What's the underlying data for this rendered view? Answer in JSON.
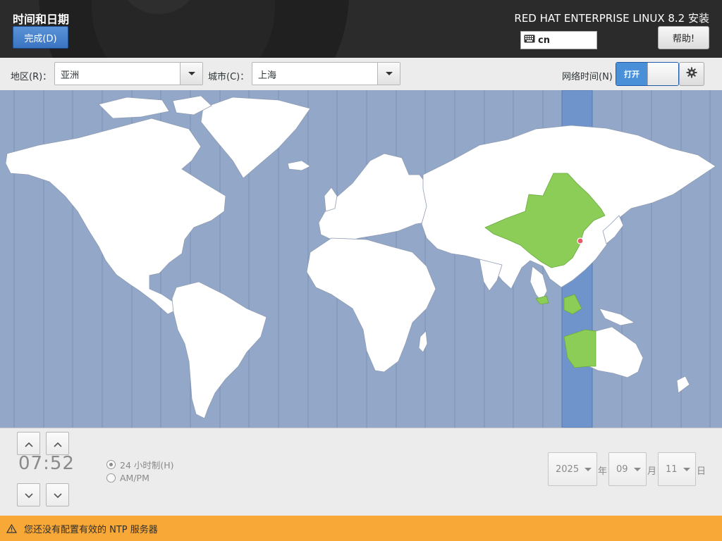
{
  "header": {
    "title": "时间和日期",
    "done_label": "完成(D)",
    "product_title": "RED HAT ENTERPRISE LINUX 8.2 安装",
    "keyboard_layout": "cn",
    "keyboard_icon": "keyboard-icon",
    "help_label": "帮助!"
  },
  "toolbar": {
    "region_label": "地区(R)：",
    "region_value": "亚洲",
    "city_label": "城市(C)：",
    "city_value": "上海",
    "network_time_label": "网络时间(N)",
    "network_time_state": "打开",
    "settings_icon": "gear-icon"
  },
  "map": {
    "selected_timezone": "Asia/Shanghai",
    "ocean_color": "#93a7c9",
    "land_color": "#ffffff",
    "highlight_color": "#8ccd58",
    "band_color": "#6f93cb"
  },
  "time": {
    "value": "07:52",
    "format_24h_label": "24 小时制(H)",
    "format_ampm_label": "AM/PM",
    "selected_format": "24h"
  },
  "date": {
    "year": "2025",
    "year_suffix": "年",
    "month": "09",
    "month_suffix": "月",
    "day": "11",
    "day_suffix": "日"
  },
  "warning": {
    "icon": "warning-icon",
    "text": "您还没有配置有效的 NTP 服务器"
  }
}
